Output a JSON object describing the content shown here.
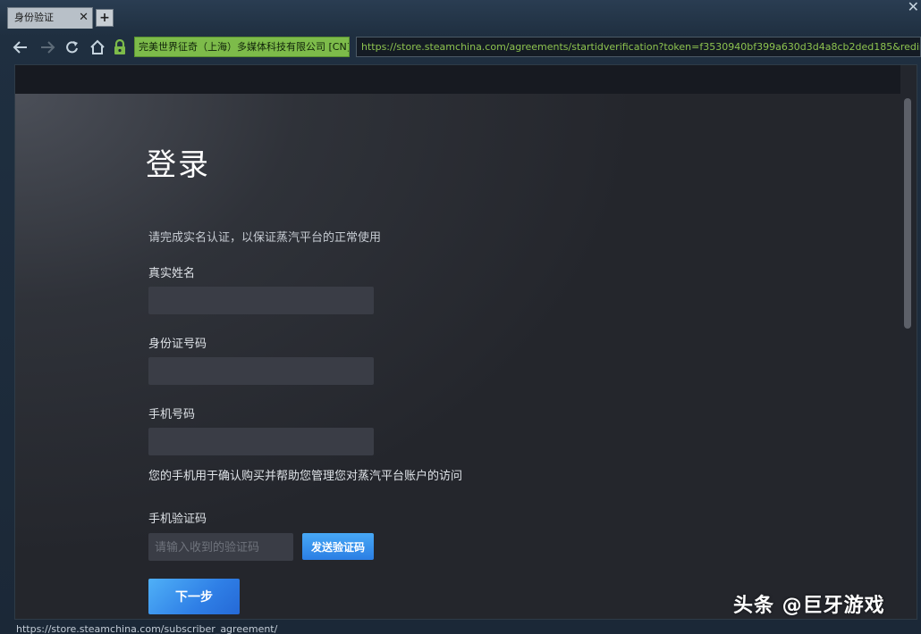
{
  "browser": {
    "tab_title": "身份验证",
    "tab_close": "✕",
    "new_tab": "+",
    "window_close": "✕",
    "cert_label": "完美世界征奇（上海）多媒体科技有限公司 [CN]",
    "url": "https://store.steamchina.com/agreements/startidverification?token=f3530940bf399a630d3d4a8cb2ded185&redir=https://store.st",
    "status_url": "https://store.steamchina.com/subscriber_agreement/",
    "nav_icons": [
      "back-icon",
      "forward-icon",
      "reload-icon",
      "home-icon",
      "lock-icon"
    ]
  },
  "form": {
    "title": "登录",
    "subtitle": "请完成实名认证，以保证蒸汽平台的正常使用",
    "real_name_label": "真实姓名",
    "id_number_label": "身份证号码",
    "phone_label": "手机号码",
    "phone_help": "您的手机用于确认购买并帮助您管理您对蒸汽平台账户的访问",
    "sms_code_label": "手机验证码",
    "sms_code_placeholder": "请输入收到的验证码",
    "send_code_button": "发送验证码",
    "next_button": "下一步"
  },
  "watermark": "头条 @巨牙游戏",
  "colors": {
    "accent_blue": "#2b7ee4",
    "cert_green": "#7dbb4a",
    "url_green": "#8dc34f",
    "input_bg": "#3a3d46"
  }
}
